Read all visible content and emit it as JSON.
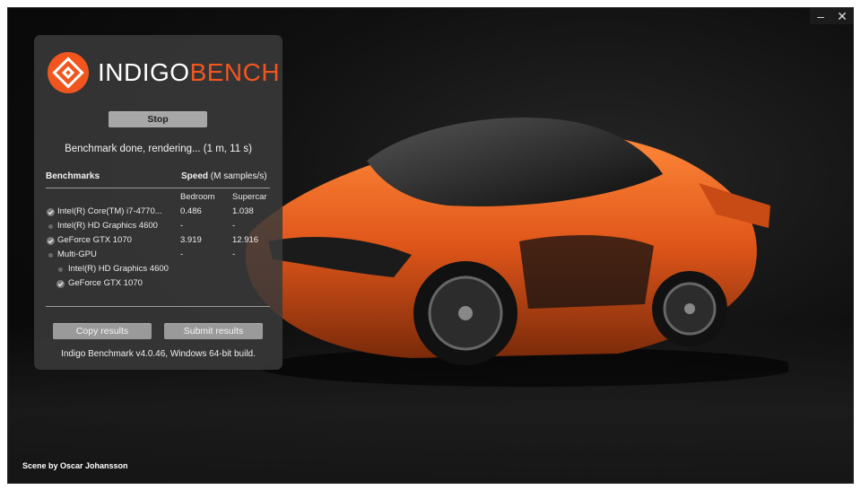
{
  "window": {
    "minimize_glyph": "–",
    "close_glyph": "✕",
    "credit": "Scene by Oscar Johansson"
  },
  "logo": {
    "text_white": "INDIGO",
    "text_orange": "BENCH",
    "accent_color": "#f2561f"
  },
  "controls": {
    "stop_label": "Stop",
    "status": "Benchmark done, rendering... (1 m, 11 s)"
  },
  "benchmarks": {
    "header_label": "Benchmarks",
    "speed_label": "Speed",
    "speed_unit": "(M samples/s)",
    "col_bedroom": "Bedroom",
    "col_supercar": "Supercar",
    "rows": [
      {
        "name": "Intel(R) Core(TM) i7-4770...",
        "bedroom": "0.486",
        "supercar": "1.038",
        "icon": "check-icon"
      },
      {
        "name": "Intel(R) HD Graphics 4600",
        "bedroom": "-",
        "supercar": "-",
        "icon": "dot-icon"
      },
      {
        "name": "GeForce GTX 1070",
        "bedroom": "3.919",
        "supercar": "12.916",
        "icon": "check-icon"
      },
      {
        "name": "Multi-GPU",
        "bedroom": "-",
        "supercar": "-",
        "icon": "dot-icon"
      },
      {
        "name": "Intel(R) HD Graphics 4600",
        "bedroom": "",
        "supercar": "",
        "icon": "dot-icon"
      },
      {
        "name": "GeForce GTX 1070",
        "bedroom": "",
        "supercar": "",
        "icon": "check-icon"
      }
    ]
  },
  "actions": {
    "copy_label": "Copy results",
    "submit_label": "Submit results"
  },
  "footer": {
    "version": "Indigo Benchmark v4.0.46, Windows 64-bit build."
  }
}
